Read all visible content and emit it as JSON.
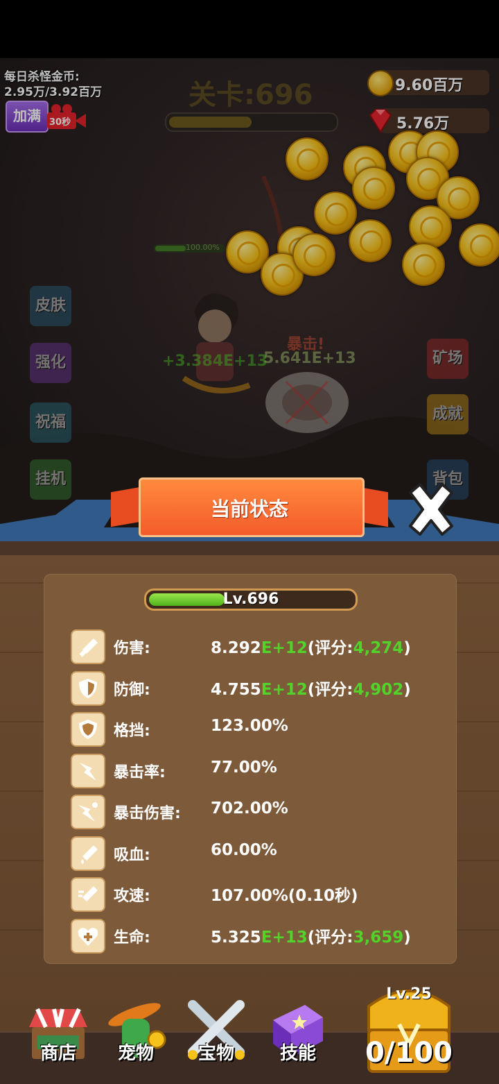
{
  "hud": {
    "daily_title": "每日杀怪金币:",
    "daily_value": "2.95万/3.92百万",
    "fill_button": "加满",
    "video_timer": "30秒",
    "stage_title": "关卡:696",
    "stage_progress": 0.5,
    "gold": "9.60百万",
    "gems": "5.76万"
  },
  "battle": {
    "hp_percent": "100.00%",
    "crit_label": "暴击!",
    "heal_number": "+3.384E+13",
    "damage_number": "5.641E+13"
  },
  "side_menu": {
    "left": [
      "皮肤",
      "强化",
      "祝福",
      "挂机"
    ],
    "right": [
      "矿场",
      "成就",
      "背包"
    ]
  },
  "panel": {
    "title": "当前状态",
    "level": "Lv.696",
    "level_progress": 0.37,
    "stats": [
      {
        "icon": "sword-icon",
        "label": "伤害:",
        "base": "8.292",
        "exp": "E+12",
        "pre": "(评分:",
        "score": "4,274",
        "post": ")"
      },
      {
        "icon": "shield-icon",
        "label": "防御:",
        "base": "4.755",
        "exp": "E+12",
        "pre": "(评分:",
        "score": "4,902",
        "post": ")"
      },
      {
        "icon": "block-icon",
        "label": "格挡:",
        "base": "123.00%",
        "exp": "",
        "pre": "",
        "score": "",
        "post": ""
      },
      {
        "icon": "crit-rate-icon",
        "label": "暴击率:",
        "base": "77.00%",
        "exp": "",
        "pre": "",
        "score": "",
        "post": ""
      },
      {
        "icon": "crit-damage-icon",
        "label": "暴击伤害:",
        "base": "702.00%",
        "exp": "",
        "pre": "",
        "score": "",
        "post": ""
      },
      {
        "icon": "lifesteal-icon",
        "label": "吸血:",
        "base": "60.00%",
        "exp": "",
        "pre": "",
        "score": "",
        "post": ""
      },
      {
        "icon": "attack-speed-icon",
        "label": "攻速:",
        "base": "107.00%(0.10秒)",
        "exp": "",
        "pre": "",
        "score": "",
        "post": ""
      },
      {
        "icon": "health-icon",
        "label": "生命:",
        "base": "5.325",
        "exp": "E+13",
        "pre": "(评分:",
        "score": "3,659",
        "post": ")"
      }
    ]
  },
  "bottom_nav": {
    "shop": "商店",
    "pet": "宠物",
    "treasure": "宝物",
    "skill": "技能",
    "chest_level": "Lv.25",
    "chest_count": "0/100"
  },
  "colors": {
    "accent_green": "#52d22a",
    "banner_orange": "#f45b2b",
    "panel_brown": "#7d5a3a"
  }
}
